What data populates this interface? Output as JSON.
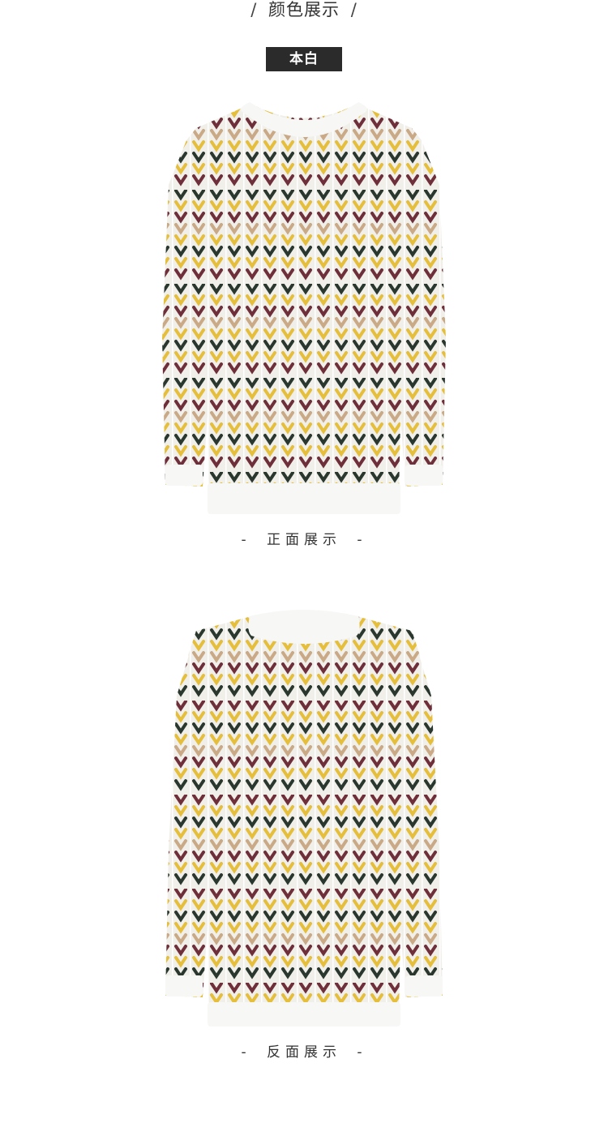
{
  "header": {
    "slash_left": "/",
    "title": "颜色展示",
    "slash_right": "/"
  },
  "color_badge": {
    "label": "本白",
    "background": "#2b2b2b",
    "text_color": "#ffffff"
  },
  "front_view": {
    "image_name": "sweater-front-image",
    "caption": {
      "dash_left": "-",
      "text": "正面展示",
      "dash_right": "-"
    }
  },
  "back_view": {
    "image_name": "sweater-back-image",
    "caption": {
      "dash_left": "-",
      "text": "反面展示",
      "dash_right": "-"
    }
  },
  "palette": {
    "base_knit": "#f1efe9",
    "yellow": "#e5be3c",
    "burgundy": "#6e2f3b",
    "dark_green": "#29372f",
    "tan": "#c9a986",
    "rib_white": "#f7f7f5"
  }
}
